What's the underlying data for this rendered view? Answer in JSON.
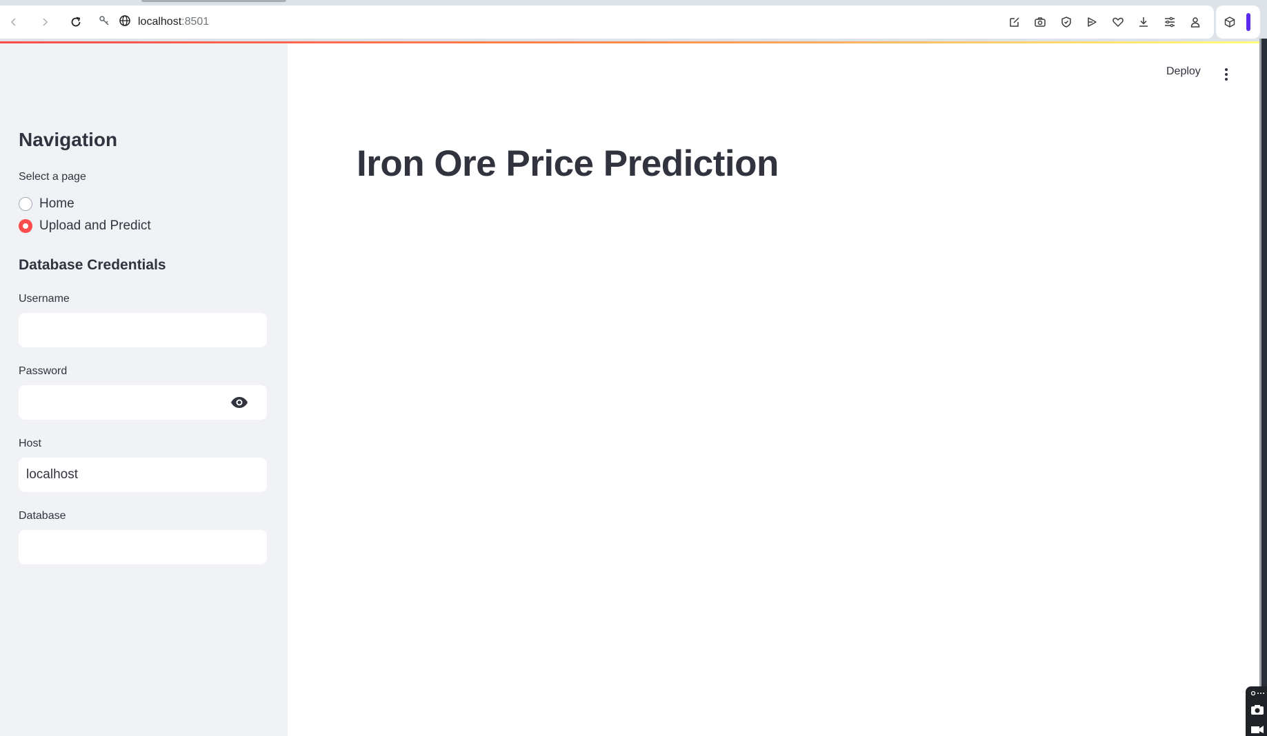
{
  "browser": {
    "url_host": "localhost",
    "url_port": ":8501",
    "icons": [
      "back-icon",
      "forward-icon",
      "reload-icon",
      "site-info-icon",
      "globe-icon",
      "edit-icon",
      "camera-icon",
      "shield-icon",
      "play-icon",
      "heart-icon",
      "download-icon",
      "sliders-icon",
      "profile-icon",
      "extension-cube-icon"
    ]
  },
  "sidebar": {
    "title": "Navigation",
    "select_label": "Select a page",
    "pages": [
      {
        "label": "Home",
        "selected": false
      },
      {
        "label": "Upload and Predict",
        "selected": true
      }
    ],
    "section_title": "Database Credentials",
    "fields": {
      "username": {
        "label": "Username",
        "value": ""
      },
      "password": {
        "label": "Password",
        "value": ""
      },
      "host": {
        "label": "Host",
        "value": "localhost"
      },
      "database": {
        "label": "Database",
        "value": ""
      }
    }
  },
  "header": {
    "deploy_label": "Deploy"
  },
  "main": {
    "title": "Iron Ore Price Prediction"
  },
  "colors": {
    "accent": "#ff4b4b",
    "sidebar_bg": "#f0f2f6",
    "text": "#31333f"
  }
}
